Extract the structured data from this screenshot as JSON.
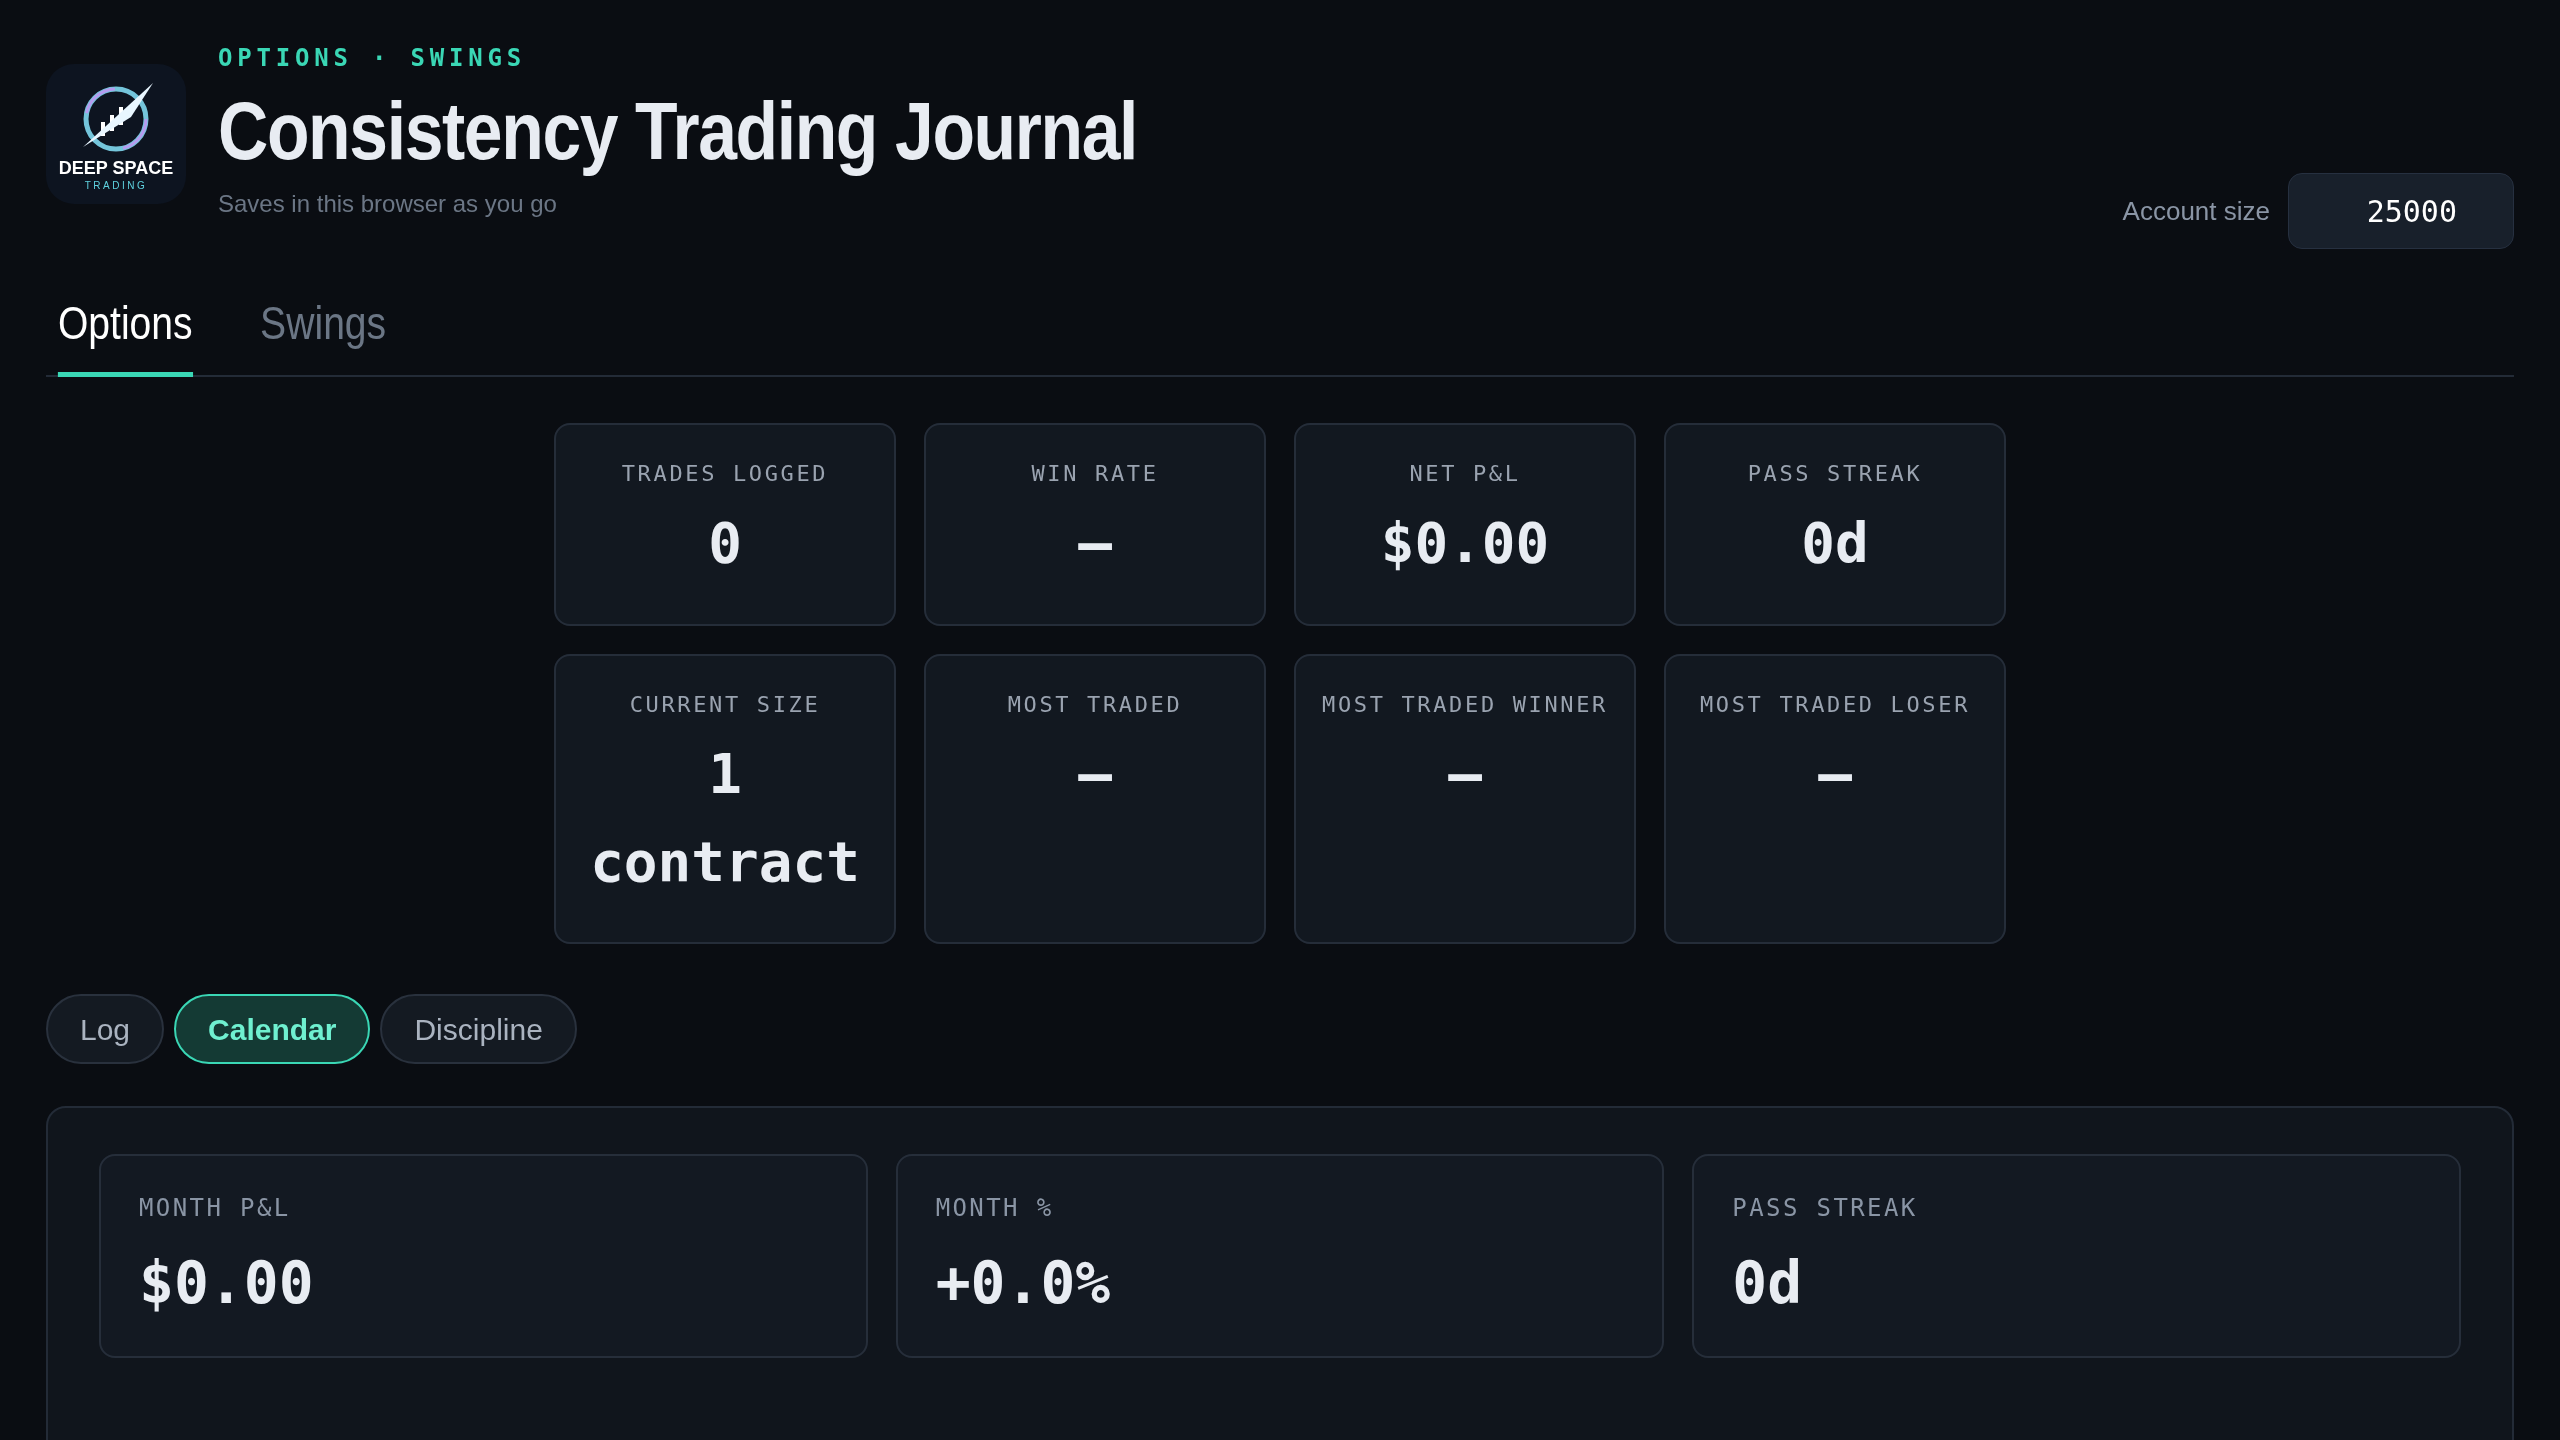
{
  "header": {
    "eyebrow": "OPTIONS · SWINGS",
    "title": "Consistency Trading Journal",
    "subtitle": "Saves in this browser as you go",
    "logo": {
      "line_1": "DEEP SPACE",
      "line_2": "TRADING"
    }
  },
  "account": {
    "label": "Account size",
    "value": "25000"
  },
  "tabs": [
    {
      "label": "Options",
      "selected": true
    },
    {
      "label": "Swings",
      "selected": false
    }
  ],
  "stats": [
    {
      "label": "TRADES LOGGED",
      "value": "0"
    },
    {
      "label": "WIN RATE",
      "value": "—"
    },
    {
      "label": "NET P&L",
      "value": "$0.00"
    },
    {
      "label": "PASS STREAK",
      "value": "0d"
    },
    {
      "label": "CURRENT SIZE",
      "value": "1 contract"
    },
    {
      "label": "MOST TRADED",
      "value": "—"
    },
    {
      "label": "MOST TRADED WINNER",
      "value": "—"
    },
    {
      "label": "MOST TRADED LOSER",
      "value": "—"
    }
  ],
  "views": [
    {
      "label": "Log",
      "selected": false
    },
    {
      "label": "Calendar",
      "selected": true
    },
    {
      "label": "Discipline",
      "selected": false
    }
  ],
  "month_summary": [
    {
      "label": "MONTH P&L",
      "value": "$0.00"
    },
    {
      "label": "MONTH %",
      "value": "+0.0%"
    },
    {
      "label": "PASS STREAK",
      "value": "0d"
    }
  ]
}
